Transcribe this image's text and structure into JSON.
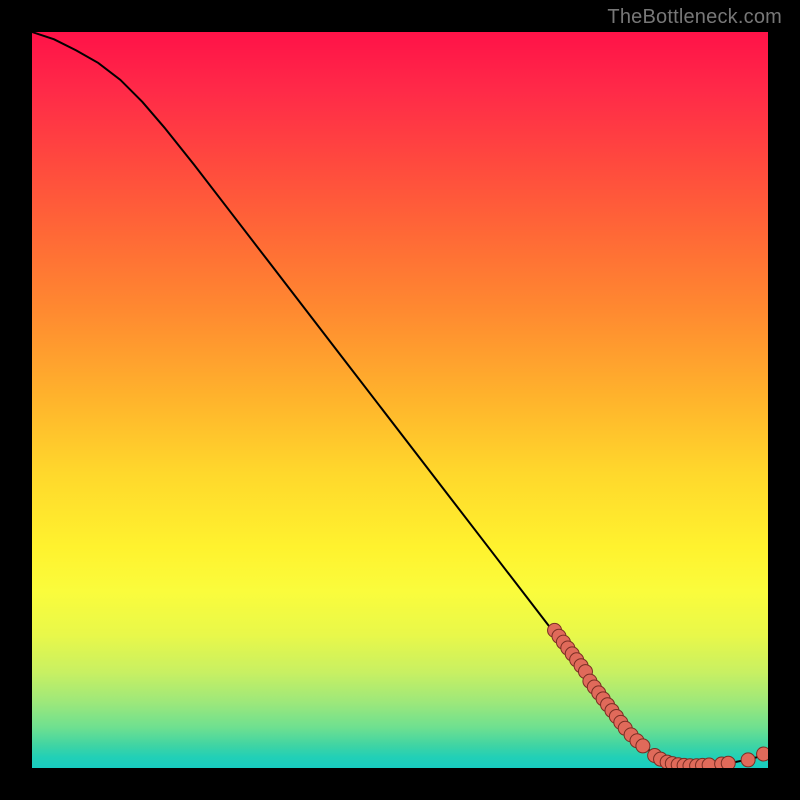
{
  "watermark": "TheBottleneck.com",
  "colors": {
    "dot_fill": "#e06a5a",
    "dot_stroke": "#7a2e24",
    "curve": "#000000"
  },
  "chart_data": {
    "type": "line",
    "title": "",
    "xlabel": "",
    "ylabel": "",
    "xlim": [
      0,
      100
    ],
    "ylim": [
      0,
      100
    ],
    "curve": [
      {
        "x": 0,
        "y": 100
      },
      {
        "x": 3,
        "y": 99
      },
      {
        "x": 6,
        "y": 97.5
      },
      {
        "x": 9,
        "y": 95.8
      },
      {
        "x": 12,
        "y": 93.5
      },
      {
        "x": 15,
        "y": 90.5
      },
      {
        "x": 18,
        "y": 87
      },
      {
        "x": 22,
        "y": 82
      },
      {
        "x": 27,
        "y": 75.5
      },
      {
        "x": 32,
        "y": 69
      },
      {
        "x": 37,
        "y": 62.5
      },
      {
        "x": 42,
        "y": 56
      },
      {
        "x": 47,
        "y": 49.5
      },
      {
        "x": 52,
        "y": 43
      },
      {
        "x": 57,
        "y": 36.5
      },
      {
        "x": 62,
        "y": 30
      },
      {
        "x": 67,
        "y": 23.5
      },
      {
        "x": 72,
        "y": 17
      },
      {
        "x": 77,
        "y": 10.5
      },
      {
        "x": 80,
        "y": 6.5
      },
      {
        "x": 83,
        "y": 3.2
      },
      {
        "x": 85,
        "y": 1.4
      },
      {
        "x": 87,
        "y": 0.6
      },
      {
        "x": 89,
        "y": 0.3
      },
      {
        "x": 92,
        "y": 0.4
      },
      {
        "x": 95,
        "y": 0.7
      },
      {
        "x": 98,
        "y": 1.3
      },
      {
        "x": 100,
        "y": 2.0
      }
    ],
    "dots": [
      {
        "x": 71.0,
        "y": 18.7
      },
      {
        "x": 71.6,
        "y": 17.9
      },
      {
        "x": 72.2,
        "y": 17.1
      },
      {
        "x": 72.8,
        "y": 16.3
      },
      {
        "x": 73.4,
        "y": 15.5
      },
      {
        "x": 74.0,
        "y": 14.7
      },
      {
        "x": 74.6,
        "y": 13.9
      },
      {
        "x": 75.2,
        "y": 13.1
      },
      {
        "x": 75.8,
        "y": 11.8
      },
      {
        "x": 76.4,
        "y": 11.0
      },
      {
        "x": 77.0,
        "y": 10.2
      },
      {
        "x": 77.6,
        "y": 9.4
      },
      {
        "x": 78.2,
        "y": 8.6
      },
      {
        "x": 78.8,
        "y": 7.8
      },
      {
        "x": 79.4,
        "y": 7.0
      },
      {
        "x": 80.0,
        "y": 6.2
      },
      {
        "x": 80.6,
        "y": 5.4
      },
      {
        "x": 81.4,
        "y": 4.5
      },
      {
        "x": 82.2,
        "y": 3.7
      },
      {
        "x": 83.0,
        "y": 3.0
      },
      {
        "x": 84.6,
        "y": 1.7
      },
      {
        "x": 85.4,
        "y": 1.2
      },
      {
        "x": 86.3,
        "y": 0.8
      },
      {
        "x": 87.0,
        "y": 0.6
      },
      {
        "x": 87.8,
        "y": 0.45
      },
      {
        "x": 88.6,
        "y": 0.35
      },
      {
        "x": 89.4,
        "y": 0.3
      },
      {
        "x": 90.3,
        "y": 0.3
      },
      {
        "x": 91.1,
        "y": 0.35
      },
      {
        "x": 92.0,
        "y": 0.4
      },
      {
        "x": 93.7,
        "y": 0.55
      },
      {
        "x": 94.6,
        "y": 0.65
      },
      {
        "x": 97.3,
        "y": 1.1
      },
      {
        "x": 99.4,
        "y": 1.9
      }
    ]
  }
}
